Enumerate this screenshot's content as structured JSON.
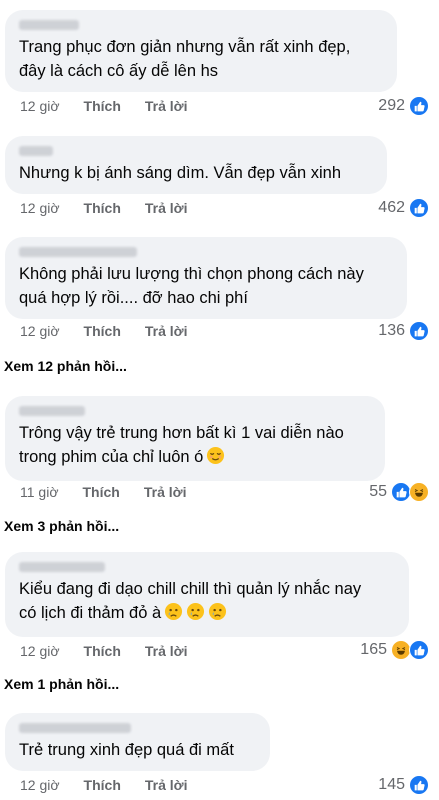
{
  "actions": {
    "like": "Thích",
    "reply": "Trả lời"
  },
  "comments": [
    {
      "author_width": 60,
      "text": "Trang phục đơn giản nhưng vẫn rất xinh đẹp,\nđây là cách cô ấy dễ lên hs",
      "time": "12 giờ",
      "count": "292",
      "reactions": [
        "like"
      ]
    },
    {
      "author_width": 34,
      "text": "Nhưng k bị ánh sáng dìm. Vẫn đẹp vẫn xinh",
      "time": "12 giờ",
      "count": "462",
      "reactions": [
        "like"
      ]
    },
    {
      "author_width": 118,
      "text": "Không phải lưu lượng thì chọn phong cách này\nquá hợp lý rồi.... đỡ hao chi phí",
      "time": "12 giờ",
      "count": "136",
      "reactions": [
        "like"
      ]
    },
    {
      "author_width": 66,
      "text": "Trông vậy trẻ trung hơn bất kì 1 vai diễn nào\ntrong phim của chỉ luôn ó",
      "time": "11 giờ",
      "count": "55",
      "reactions": [
        "like",
        "haha"
      ]
    },
    {
      "author_width": 86,
      "text": "Kiểu đang đi dạo chill chill thì quản lý nhắc nay\ncó lịch đi thảm đỏ à",
      "time": "12 giờ",
      "count": "165",
      "reactions": [
        "haha",
        "like"
      ]
    },
    {
      "author_width": 112,
      "text": "Trẻ trung xinh đẹp quá đi mất",
      "time": "12 giờ",
      "count": "145",
      "reactions": [
        "like"
      ]
    }
  ],
  "more_replies": [
    "Xem 12 phản hồi...",
    "Xem 3 phản hồi...",
    "Xem 1 phản hồi..."
  ],
  "icons": {
    "like": "thumbs-up",
    "haha": "laughing-face",
    "relieved": "relieved-face",
    "crying": "crying-face"
  }
}
